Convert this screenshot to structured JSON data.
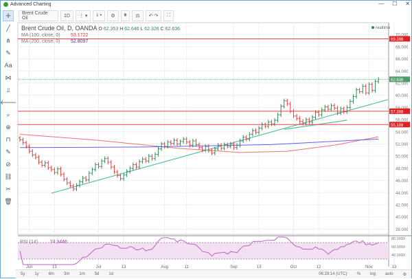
{
  "window": {
    "title": "Advanced Charting",
    "min": "—",
    "max": "☐",
    "close": "✕"
  },
  "toolbar": {
    "symbol": "Brent Crude Oil",
    "interval": "1D",
    "items": [
      "⋮ ▾",
      "⫰ ▾",
      "⚙",
      "⩩",
      "⚖",
      "↶ ↷",
      "⛶"
    ]
  },
  "sidebar": {
    "tools": [
      "✛",
      "╱",
      "⋔",
      "✎",
      "Aa",
      "⋈",
      "⫫",
      "🡐",
      "⌕",
      "⊕",
      "⊓",
      "✎",
      "⊘",
      "⛓",
      "✂",
      "🗑"
    ]
  },
  "legend": {
    "title": "Brent Crude Oil, D, OANDA",
    "o_label": "O",
    "o": "62.353",
    "h_label": "H",
    "h": "62.646",
    "l_label": "L",
    "l": "62.326",
    "c_label": "C",
    "c": "62.636",
    "ma100_label": "MA (100, close, 0)",
    "ma100": "53.1722",
    "ma200_label": "MA (200, close, 0)",
    "ma200": "52.8097",
    "rsi_label": "RSI (14)",
    "rsi": "74.3446"
  },
  "realtime": "realtime",
  "colors": {
    "up": "#2e8b57",
    "down": "#e0403a",
    "ma100": "#f07070",
    "ma200": "#6060ee",
    "trend": "#5bbfa8",
    "hline": "#f04040",
    "rsi": "#c060c8"
  },
  "chart_data": {
    "type": "ohlc",
    "symbol": "Brent Crude Oil",
    "ylim": [
      37,
      71
    ],
    "yticks": [
      "70.000",
      "68.000",
      "66.000",
      "64.000",
      "62.000",
      "60.000",
      "58.000",
      "56.000",
      "54.000",
      "52.000",
      "50.000",
      "48.000",
      "46.000",
      "44.000",
      "42.000",
      "40.000",
      "38.000"
    ],
    "closes": [
      52.7,
      52.2,
      51.6,
      50.8,
      50.2,
      49.8,
      49.0,
      48.5,
      48.9,
      48.1,
      47.8,
      47.3,
      47.9,
      47.0,
      46.2,
      45.6,
      45.1,
      44.6,
      45.2,
      45.8,
      46.4,
      46.1,
      47.2,
      47.8,
      48.6,
      48.3,
      49.2,
      49.6,
      49.0,
      48.2,
      47.4,
      46.8,
      46.3,
      46.9,
      47.5,
      48.0,
      48.6,
      48.2,
      49.1,
      49.5,
      49.2,
      50.0,
      49.6,
      50.3,
      51.2,
      52.0,
      51.6,
      52.3,
      52.1,
      52.6,
      52.0,
      52.4,
      52.8,
      52.3,
      51.8,
      52.5,
      51.9,
      51.4,
      51.0,
      51.6,
      50.9,
      50.5,
      51.2,
      51.8,
      51.3,
      51.9,
      51.6,
      52.0,
      51.4,
      51.8,
      52.5,
      53.1,
      52.8,
      53.6,
      54.2,
      53.9,
      54.6,
      55.2,
      54.9,
      55.6,
      55.3,
      55.9,
      56.8,
      58.2,
      59.1,
      58.6,
      57.4,
      56.6,
      56.2,
      55.7,
      55.4,
      56.0,
      55.6,
      56.4,
      57.2,
      56.8,
      57.6,
      58.1,
      57.7,
      58.3,
      57.9,
      57.1,
      57.8,
      57.3,
      58.0,
      59.0,
      59.8,
      60.9,
      60.6,
      61.5,
      60.4,
      61.8,
      60.8,
      62.3,
      62.636
    ],
    "ma100": [
      [
        0,
        53.6
      ],
      [
        25,
        52.6
      ],
      [
        50,
        51.3
      ],
      [
        70,
        50.6
      ],
      [
        85,
        50.8
      ],
      [
        100,
        51.8
      ],
      [
        114,
        53.17
      ]
    ],
    "ma200": [
      [
        0,
        51.4
      ],
      [
        40,
        51.5
      ],
      [
        80,
        51.9
      ],
      [
        114,
        52.81
      ]
    ],
    "hlines": [
      {
        "value": 69.288,
        "label": "69.288"
      },
      {
        "value": 57.388,
        "label": "57.388"
      },
      {
        "value": 55.188,
        "label": "55.188"
      }
    ],
    "last_price": {
      "value": 62.636,
      "label": "62.636"
    },
    "trendlines": [
      [
        [
          10,
          43.9
        ],
        [
          117,
          59.3
        ]
      ],
      [
        [
          84,
          54.4
        ],
        [
          104,
          55.9
        ]
      ]
    ],
    "rsi": {
      "period": 14,
      "yticks": [
        "80.0000",
        "60.0000",
        "40.0000"
      ],
      "overbought": 70,
      "oversold": 30
    },
    "xticks": [
      {
        "i": 3,
        "label": "Jun"
      },
      {
        "i": 11,
        "label": "13"
      },
      {
        "i": 25,
        "label": "Jul"
      },
      {
        "i": 33,
        "label": "13"
      },
      {
        "i": 46,
        "label": "Aug"
      },
      {
        "i": 53,
        "label": "11"
      },
      {
        "i": 68,
        "label": "Sep"
      },
      {
        "i": 76,
        "label": "13"
      },
      {
        "i": 87,
        "label": "Oct"
      },
      {
        "i": 95,
        "label": "12"
      },
      {
        "i": 111,
        "label": "Nov"
      },
      {
        "i": 119,
        "label": "13"
      }
    ]
  },
  "bottom": {
    "ranges": [
      "5y",
      "1y",
      "6m",
      "3m",
      "1m",
      "5d",
      "1d"
    ],
    "time": "06:29:14 (UTC)",
    "pct": "%",
    "log": "log",
    "auto": "auto"
  }
}
